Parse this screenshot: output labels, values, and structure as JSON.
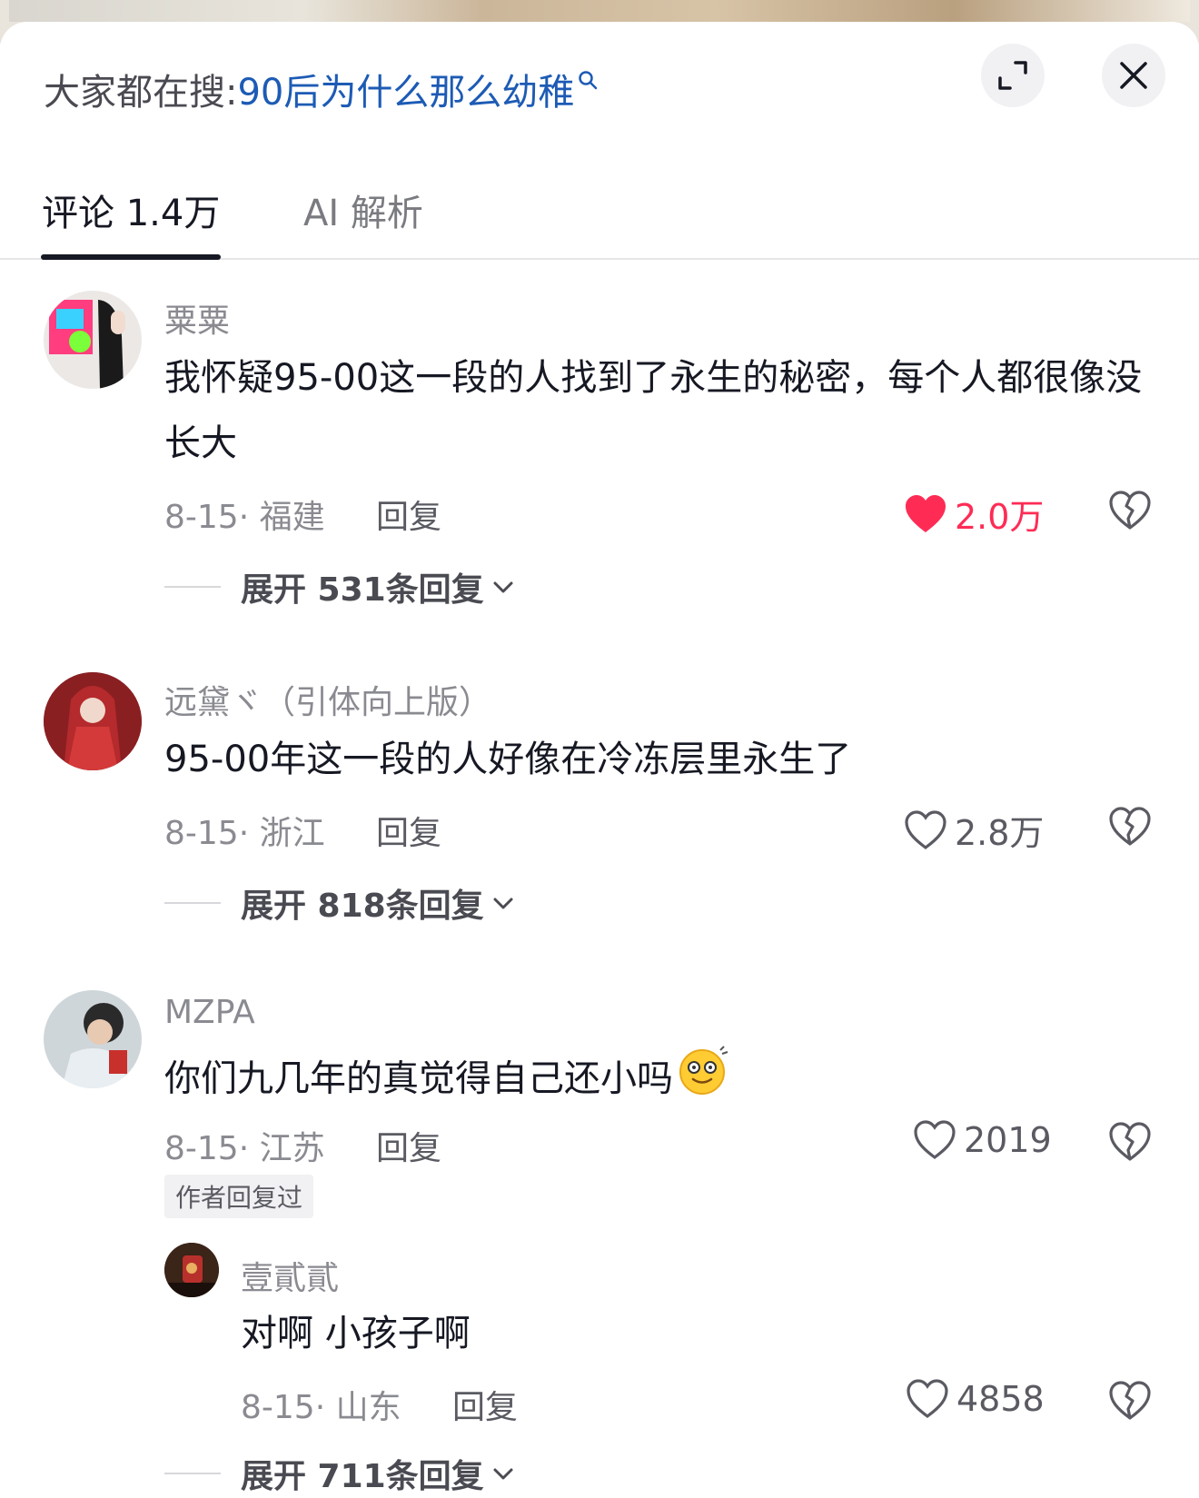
{
  "search": {
    "prefix": "大家都在搜:",
    "term": "90后为什么那么幼稚"
  },
  "tabs": [
    {
      "label": "评论 1.4万"
    },
    {
      "label": "AI 解析"
    }
  ],
  "comments": [
    {
      "username": "粟粟",
      "text": "我怀疑95-00这一段的人找到了永生的秘密，每个人都很像没长大",
      "meta": "8-15· 福建",
      "reply_label": "回复",
      "likes": "2.0万",
      "liked": true,
      "expand_label": "展开 531条回复"
    },
    {
      "username": "远黛ヾ（引体向上版）",
      "text": "95-00年这一段的人好像在冷冻层里永生了",
      "meta": "8-15· 浙江",
      "reply_label": "回复",
      "likes": "2.8万",
      "liked": false,
      "expand_label": "展开 818条回复"
    },
    {
      "username": "MZPA",
      "text": "你们九几年的真觉得自己还小吗",
      "meta": "8-15· 江苏",
      "reply_label": "回复",
      "likes": "2019",
      "liked": false,
      "badge": "作者回复过",
      "reply": {
        "username": "壹貳貳",
        "text": "对啊  小孩子啊",
        "meta": "8-15· 山东",
        "reply_label": "回复",
        "likes": "4858",
        "liked": false
      },
      "expand_label": "展开 711条回复"
    }
  ],
  "colors": {
    "accent_like": "#fe2c55",
    "search_link": "#1d5bb5"
  }
}
